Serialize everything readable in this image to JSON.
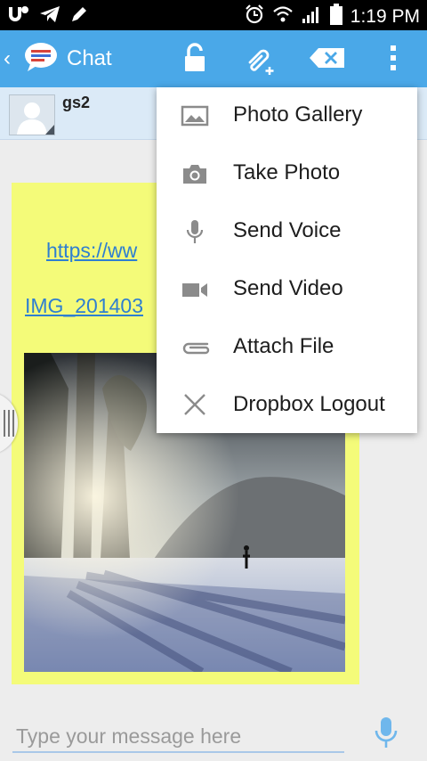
{
  "status_bar": {
    "time": "1:19 PM"
  },
  "app_bar": {
    "title": "Chat"
  },
  "contact": {
    "name": "gs2"
  },
  "messages": {
    "link_1": "https://ww",
    "link_2": "IMG_201403"
  },
  "menu": {
    "items": [
      {
        "label": "Photo Gallery",
        "icon": "gallery-icon"
      },
      {
        "label": "Take Photo",
        "icon": "camera-icon"
      },
      {
        "label": "Send Voice",
        "icon": "mic-icon"
      },
      {
        "label": "Send Video",
        "icon": "video-icon"
      },
      {
        "label": "Attach File",
        "icon": "paperclip-icon"
      },
      {
        "label": "Dropbox Logout",
        "icon": "close-icon"
      }
    ]
  },
  "composer": {
    "placeholder": "Type your message here"
  },
  "colors": {
    "app_bar": "#4aa8e8",
    "bubble": "#f4fb79",
    "link": "#2f7fd0"
  }
}
